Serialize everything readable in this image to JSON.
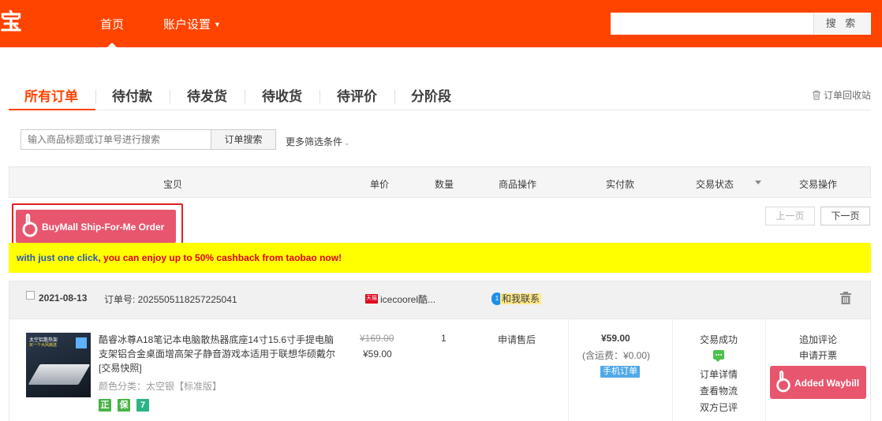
{
  "header": {
    "logo_char": "宝",
    "nav_home": "首页",
    "nav_account": "账户设置",
    "search_placeholder": "",
    "search_button": "搜 索"
  },
  "tabs": {
    "items": [
      "所有订单",
      "待付款",
      "待发货",
      "待收货",
      "待评价",
      "分阶段"
    ],
    "active_index": 0,
    "recycle": "订单回收站"
  },
  "order_search": {
    "placeholder": "输入商品标题或订单号进行搜索",
    "button": "订单搜索",
    "more_filters": "更多筛选条件"
  },
  "table_header": {
    "item": "宝贝",
    "unit_price": "单价",
    "quantity": "数量",
    "item_ops": "商品操作",
    "paid": "实付款",
    "status": "交易状态",
    "ops": "交易操作"
  },
  "buymall": {
    "label": "BuyMall Ship-For-Me Order"
  },
  "pager": {
    "prev": "上一页",
    "next": "下一页"
  },
  "promo": {
    "part1": "with just one click",
    "part2": ", you can enjoy up to 50% cashback from taobao now!"
  },
  "order": {
    "date": "2021-08-13",
    "order_no_label": "订单号: 2025505118257225041",
    "tmall_badge": "天猫",
    "shop": "icecoorel酷...",
    "contact_badge": "1",
    "contact": "和我联系",
    "product_title": "酷睿冰尊A18笔记本电脑散热器底座14寸15.6寸手提电脑支架铝合金桌面增高架子静音游戏本适用于联想华硕戴尔 [交易快照]",
    "sku": "颜色分类：太空银【标准版】",
    "thumb_banner": "太空铝散热架",
    "thumb_banner2": "买一个大风扇送",
    "service_icons": [
      "正",
      "保",
      "7"
    ],
    "service_colors": [
      "#47b347",
      "#47b347",
      "#2db389"
    ],
    "price_original": "¥169.00",
    "price_current": "¥59.00",
    "quantity": "1",
    "after_sale": "申请售后",
    "paid": "¥59.00",
    "shipping": "(含运费：¥0.00)",
    "mobile_tag": "手机订单",
    "status": "交易成功",
    "status_links": [
      "订单详情",
      "查看物流",
      "双方已评"
    ],
    "ops_links": [
      "追加评论",
      "申请开票"
    ],
    "waybill_label": "Added Waybill"
  },
  "colors": {
    "brand": "#ff4400",
    "buymall": "#e8566e",
    "highlight_frame": "#e02020",
    "promo_bg": "#ffff00"
  }
}
